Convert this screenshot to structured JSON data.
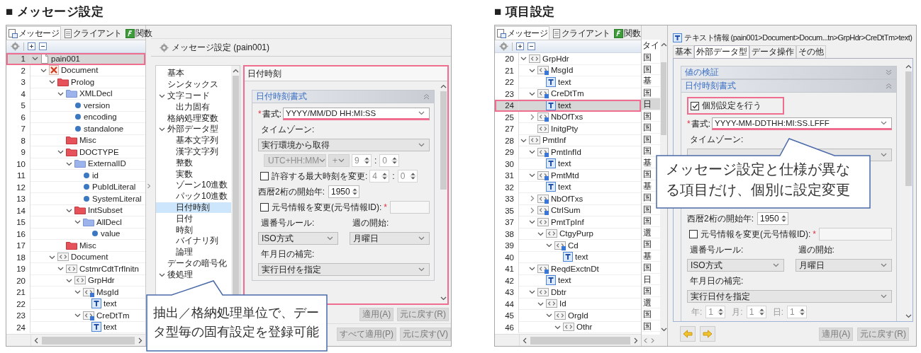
{
  "message_settings": {
    "heading": "■ メッセージ設定",
    "tree": {
      "tabs": [
        {
          "label": "メッセージ",
          "kind": "message",
          "selected": true
        },
        {
          "label": "クライアント",
          "kind": "client",
          "selected": false
        },
        {
          "label": "関数",
          "kind": "function",
          "selected": false
        }
      ],
      "nodes": [
        {
          "row": "1",
          "label": "pain001",
          "kind": "page",
          "expanded": true,
          "selected": true,
          "highlighted": true,
          "children": [
            {
              "row": "2",
              "label": "Document",
              "kind": "xdoc",
              "expanded": true,
              "selected": false,
              "children": [
                {
                  "row": "3",
                  "label": "Prolog",
                  "kind": "folder-red",
                  "expanded": true,
                  "selected": false,
                  "children": [
                    {
                      "row": "4",
                      "label": "XMLDecl",
                      "kind": "folder-blue",
                      "expanded": true,
                      "selected": false,
                      "children": [
                        {
                          "row": "5",
                          "label": "version",
                          "kind": "dot",
                          "selected": false
                        },
                        {
                          "row": "6",
                          "label": "encoding",
                          "kind": "dot",
                          "selected": false
                        },
                        {
                          "row": "7",
                          "label": "standalone",
                          "kind": "dot",
                          "selected": false
                        }
                      ]
                    },
                    {
                      "row": "8",
                      "label": "Misc",
                      "kind": "folder-red",
                      "selected": false
                    },
                    {
                      "row": "9",
                      "label": "DOCTYPE",
                      "kind": "folder-red",
                      "expanded": true,
                      "selected": false,
                      "children": [
                        {
                          "row": "10",
                          "label": "ExternalID",
                          "kind": "folder-blue",
                          "expanded": true,
                          "selected": false,
                          "children": [
                            {
                              "row": "11",
                              "label": "id",
                              "kind": "dot",
                              "selected": false
                            },
                            {
                              "row": "12",
                              "label": "PubIdLiteral",
                              "kind": "dot",
                              "selected": false
                            },
                            {
                              "row": "13",
                              "label": "SystemLiteral",
                              "kind": "dot",
                              "selected": false
                            }
                          ]
                        },
                        {
                          "row": "14",
                          "label": "IntSubset",
                          "kind": "folder-red",
                          "expanded": true,
                          "selected": false,
                          "children": [
                            {
                              "row": "15",
                              "label": "AllDecl",
                              "kind": "folder-blue",
                              "expanded": true,
                              "selected": false,
                              "children": [
                                {
                                  "row": "16",
                                  "label": "value",
                                  "kind": "dot",
                                  "selected": false
                                }
                              ]
                            }
                          ]
                        }
                      ]
                    },
                    {
                      "row": "17",
                      "label": "Misc",
                      "kind": "folder-red",
                      "selected": false
                    }
                  ]
                },
                {
                  "row": "18",
                  "label": "Document",
                  "kind": "element",
                  "expanded": true,
                  "selected": false,
                  "children": [
                    {
                      "row": "19",
                      "label": "CstmrCdtTrfInitn",
                      "kind": "element",
                      "expanded": true,
                      "selected": false,
                      "children": [
                        {
                          "row": "20",
                          "label": "GrpHdr",
                          "kind": "element",
                          "expanded": true,
                          "selected": false,
                          "children": [
                            {
                              "row": "21",
                              "label": "MsgId",
                              "kind": "element-text",
                              "expanded": true,
                              "selected": false,
                              "children": [
                                {
                                  "row": "22",
                                  "label": "text",
                                  "kind": "text",
                                  "selected": false
                                }
                              ]
                            },
                            {
                              "row": "23",
                              "label": "CreDtTm",
                              "kind": "element-text",
                              "expanded": true,
                              "selected": false,
                              "children": [
                                {
                                  "row": "24",
                                  "label": "text",
                                  "kind": "text",
                                  "selected": false
                                }
                              ]
                            }
                          ]
                        }
                      ]
                    }
                  ]
                }
              ]
            }
          ]
        }
      ]
    },
    "editor": {
      "title": "メッセージ設定 (pain001)",
      "nav": [
        {
          "label": "基本",
          "selected": false
        },
        {
          "label": "シンタックス",
          "selected": false
        },
        {
          "label": "文字コード",
          "expanded": true,
          "selected": false,
          "children": [
            {
              "label": "出力固有",
              "selected": false
            }
          ]
        },
        {
          "label": "格納処理変数",
          "selected": false
        },
        {
          "label": "外部データ型",
          "expanded": true,
          "selected": false,
          "children": [
            {
              "label": "基本文字列",
              "selected": false
            },
            {
              "label": "漢字文字列",
              "selected": false
            },
            {
              "label": "整数",
              "selected": false
            },
            {
              "label": "実数",
              "selected": false
            },
            {
              "label": "ゾーン10進数",
              "selected": false
            },
            {
              "label": "パック10進数",
              "selected": false
            },
            {
              "label": "日付時刻",
              "selected": true
            },
            {
              "label": "日付",
              "selected": false
            },
            {
              "label": "時刻",
              "selected": false
            },
            {
              "label": "バイナリ列",
              "selected": false
            },
            {
              "label": "論理",
              "selected": false
            }
          ]
        },
        {
          "label": "データの暗号化",
          "selected": false
        },
        {
          "label": "後処理",
          "expanded": true,
          "selected": false
        }
      ],
      "panel": {
        "title": "日付時刻",
        "highlighted": true,
        "sections": [
          {
            "title": "日付時刻書式",
            "expanded": true,
            "rows": [
              {
                "kind": "combo",
                "required_mark": "*",
                "label": "書式:",
                "value": "YYYY/MM/DD HH:MI:SS",
                "highlighted": true
              },
              {
                "kind": "caption",
                "text": "タイムゾーン:"
              },
              {
                "kind": "select",
                "value": "実行環境から取得",
                "disabled": false
              },
              {
                "kind": "inline",
                "items": [
                  {
                    "kind": "select",
                    "value": "UTC+HH:MM",
                    "disabled": true
                  },
                  {
                    "kind": "select",
                    "value": "+",
                    "disabled": true
                  },
                  {
                    "kind": "spinner",
                    "value": "9",
                    "disabled": true
                  },
                  {
                    "kind": "sep",
                    "text": ":"
                  },
                  {
                    "kind": "spinner",
                    "value": "0",
                    "disabled": true
                  }
                ]
              },
              {
                "kind": "inline",
                "items": [
                  {
                    "kind": "checkbox",
                    "label": "許容する最大時刻を変更:",
                    "checked": false
                  },
                  {
                    "kind": "spinner",
                    "value": "4",
                    "disabled": true
                  },
                  {
                    "kind": "sep",
                    "text": ":"
                  },
                  {
                    "kind": "spinner",
                    "value": "0",
                    "disabled": true
                  }
                ]
              },
              {
                "kind": "inline",
                "items": [
                  {
                    "kind": "label",
                    "text": "西暦2桁の開始年:",
                    "disabled": false
                  },
                  {
                    "kind": "spinner",
                    "value": "1950",
                    "disabled": false
                  }
                ]
              },
              {
                "kind": "inline",
                "items": [
                  {
                    "kind": "checkbox",
                    "label": "元号情報を変更(元号情報ID):",
                    "checked": false
                  },
                  {
                    "kind": "mark",
                    "text": "*"
                  },
                  {
                    "kind": "text-field"
                  }
                ]
              },
              {
                "kind": "pair",
                "items": [
                  {
                    "kind": "caption",
                    "text": "週番号ルール:"
                  },
                  {
                    "kind": "caption",
                    "text": "週の開始:"
                  }
                ]
              },
              {
                "kind": "pair",
                "items": [
                  {
                    "kind": "select",
                    "value": "ISO方式",
                    "disabled": false
                  },
                  {
                    "kind": "select",
                    "value": "月曜日",
                    "disabled": false
                  }
                ]
              },
              {
                "kind": "caption",
                "text": "年月日の補完:"
              },
              {
                "kind": "select",
                "value": "実行日付を指定",
                "disabled": false
              }
            ]
          }
        ]
      },
      "button_rows": [
        [
          {
            "label": "適用(A)",
            "disabled": true
          },
          {
            "label": "元に戻す(R)",
            "disabled": true
          }
        ],
        [
          {
            "label": "すべて適用(P)",
            "disabled": true
          },
          {
            "label": "元に戻す(V)",
            "disabled": true
          }
        ]
      ]
    },
    "callout": "抽出／格納処理単位で、データ型毎の固有設定を登録可能"
  },
  "item_settings": {
    "heading": "■ 項目設定",
    "tree": {
      "tabs": [
        {
          "label": "メッセージ",
          "kind": "message",
          "selected": true
        },
        {
          "label": "クライアント",
          "kind": "client",
          "selected": false
        },
        {
          "label": "関数",
          "kind": "function",
          "selected": false
        }
      ],
      "column_2_header": "タイ",
      "nodes": [
        {
          "row": "20",
          "label": "GrpHdr",
          "kind": "element",
          "expanded": true,
          "selected": false,
          "column_2": "国",
          "children": [
            {
              "row": "21",
              "label": "MsgId",
              "kind": "element-text",
              "expanded": true,
              "selected": false,
              "column_2": "国",
              "children": [
                {
                  "row": "22",
                  "label": "text",
                  "kind": "text",
                  "selected": false,
                  "column_2": "基"
                }
              ]
            },
            {
              "row": "23",
              "label": "CreDtTm",
              "kind": "element-text",
              "expanded": true,
              "selected": false,
              "column_2": "国",
              "children": [
                {
                  "row": "24",
                  "label": "text",
                  "kind": "text",
                  "selected": true,
                  "highlighted": true,
                  "column_2": "日"
                }
              ]
            },
            {
              "row": "25",
              "label": "NbOfTxs",
              "kind": "element-text",
              "expanded": false,
              "selected": false,
              "column_2": "国"
            },
            {
              "row": "27",
              "label": "InitgPty",
              "kind": "element",
              "selected": false,
              "column_2": "国"
            }
          ]
        },
        {
          "row": "28",
          "label": "PmtInf",
          "kind": "element",
          "expanded": true,
          "selected": false,
          "column_2": "国",
          "children": [
            {
              "row": "29",
              "label": "PmtInfId",
              "kind": "element-text",
              "expanded": true,
              "selected": false,
              "column_2": "国",
              "children": [
                {
                  "row": "30",
                  "label": "text",
                  "kind": "text",
                  "selected": false,
                  "column_2": "基"
                }
              ]
            },
            {
              "row": "31",
              "label": "PmtMtd",
              "kind": "element-text",
              "expanded": true,
              "selected": false,
              "column_2": "国",
              "children": [
                {
                  "row": "32",
                  "label": "text",
                  "kind": "text",
                  "selected": false,
                  "column_2": "基"
                }
              ]
            },
            {
              "row": "33",
              "label": "NbOfTxs",
              "kind": "element-text",
              "expanded": false,
              "selected": false,
              "column_2": "国"
            },
            {
              "row": "35",
              "label": "CtrlSum",
              "kind": "element-text",
              "expanded": false,
              "selected": false,
              "column_2": "国"
            },
            {
              "row": "37",
              "label": "PmtTpInf",
              "kind": "element",
              "expanded": true,
              "selected": false,
              "column_2": "国",
              "children": [
                {
                  "row": "38",
                  "label": "CtgyPurp",
                  "kind": "element",
                  "expanded": true,
                  "selected": false,
                  "column_2": "選",
                  "children": [
                    {
                      "row": "39",
                      "label": "Cd",
                      "kind": "element-text",
                      "expanded": true,
                      "selected": false,
                      "column_2": "国",
                      "children": [
                        {
                          "row": "40",
                          "label": "text",
                          "kind": "text",
                          "selected": false,
                          "column_2": "基"
                        }
                      ]
                    }
                  ]
                }
              ]
            },
            {
              "row": "41",
              "label": "ReqdExctnDt",
              "kind": "element-text",
              "expanded": true,
              "selected": false,
              "column_2": "国",
              "children": [
                {
                  "row": "42",
                  "label": "text",
                  "kind": "text",
                  "selected": false,
                  "column_2": "日"
                }
              ]
            },
            {
              "row": "43",
              "label": "Dbtr",
              "kind": "element",
              "expanded": true,
              "selected": false,
              "column_2": "国",
              "children": [
                {
                  "row": "44",
                  "label": "Id",
                  "kind": "element",
                  "expanded": true,
                  "selected": false,
                  "column_2": "選",
                  "children": [
                    {
                      "row": "45",
                      "label": "OrgId",
                      "kind": "element",
                      "expanded": true,
                      "selected": false,
                      "column_2": "国",
                      "children": [
                        {
                          "row": "46",
                          "label": "Othr",
                          "kind": "element",
                          "expanded": true,
                          "selected": false,
                          "column_2": "国"
                        }
                      ]
                    }
                  ]
                }
              ]
            }
          ]
        }
      ]
    },
    "editor": {
      "title": "テキスト情報 (pain001>Document>Docum...tn>GrpHdr>CreDtTm>text)",
      "tabs": [
        {
          "label": "基本",
          "selected": false
        },
        {
          "label": "外部データ型",
          "selected": true
        },
        {
          "label": "データ操作",
          "selected": false
        },
        {
          "label": "その他",
          "selected": false
        }
      ],
      "sections": [
        {
          "title": "値の検証",
          "expanded": false
        },
        {
          "title": "日付時刻書式",
          "expanded": true,
          "rows": [
            {
              "kind": "checkbox",
              "label": "個別設定を行う",
              "checked": true,
              "highlighted": true
            },
            {
              "kind": "combo",
              "required_mark": "*",
              "label": "書式:",
              "value": "YYYY-MM-DDTHH:MI:SS.LFFF",
              "highlighted": true
            },
            {
              "kind": "caption",
              "text": "タイムゾーン:"
            },
            {
              "kind": "select",
              "disabled": false
            },
            {
              "kind": "covered"
            },
            {
              "kind": "inline",
              "items": [
                {
                  "kind": "label",
                  "text": "西暦2桁の開始年:",
                  "disabled": false
                },
                {
                  "kind": "spinner",
                  "value": "1950",
                  "disabled": false
                }
              ]
            },
            {
              "kind": "inline",
              "items": [
                {
                  "kind": "checkbox",
                  "label": "元号情報を変更(元号情報ID):",
                  "checked": false
                },
                {
                  "kind": "mark",
                  "text": "*"
                },
                {
                  "kind": "text-field"
                }
              ]
            },
            {
              "kind": "pair",
              "items": [
                {
                  "kind": "caption",
                  "text": "週番号ルール:"
                },
                {
                  "kind": "caption",
                  "text": "週の開始:"
                }
              ]
            },
            {
              "kind": "pair",
              "items": [
                {
                  "kind": "select",
                  "value": "ISO方式",
                  "disabled": false
                },
                {
                  "kind": "select",
                  "value": "月曜日",
                  "disabled": false
                }
              ]
            },
            {
              "kind": "caption",
              "text": "年月日の補完:"
            },
            {
              "kind": "select",
              "value": "実行日付を指定",
              "disabled": false
            },
            {
              "kind": "inline",
              "items": [
                {
                  "kind": "label",
                  "text": "年:",
                  "disabled": true
                },
                {
                  "kind": "spinner",
                  "value": "1",
                  "disabled": true
                },
                {
                  "kind": "label",
                  "text": "月:",
                  "disabled": true
                },
                {
                  "kind": "spinner",
                  "value": "1",
                  "disabled": true
                },
                {
                  "kind": "label",
                  "text": "日:",
                  "disabled": true
                },
                {
                  "kind": "spinner",
                  "value": "1",
                  "disabled": true
                }
              ]
            }
          ]
        }
      ],
      "nav_buttons": [
        {
          "kind": "back"
        },
        {
          "kind": "forward"
        }
      ],
      "buttons": [
        {
          "label": "適用(A)",
          "disabled": true
        },
        {
          "label": "元に戻す(R)",
          "disabled": true
        }
      ]
    },
    "callout": "メッセージ設定と仕様が異なる項目だけ、個別に設定変更"
  }
}
